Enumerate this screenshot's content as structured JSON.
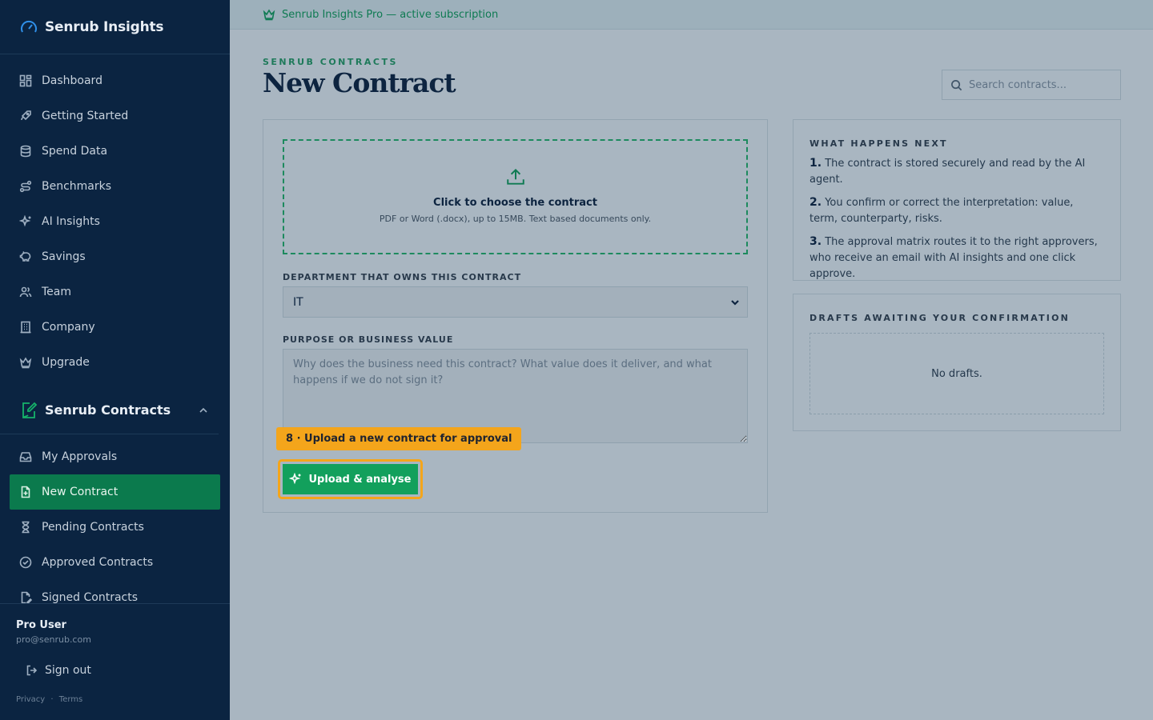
{
  "app": {
    "brand": "Senrub Insights",
    "banner_text": "Senrub Insights Pro — active subscription"
  },
  "sidebar": {
    "items": [
      {
        "label": "Dashboard",
        "icon": "grid-icon"
      },
      {
        "label": "Getting Started",
        "icon": "rocket-icon"
      },
      {
        "label": "Spend Data",
        "icon": "database-icon"
      },
      {
        "label": "Benchmarks",
        "icon": "route-icon"
      },
      {
        "label": "AI Insights",
        "icon": "sparkles-icon"
      },
      {
        "label": "Savings",
        "icon": "piggy-bank-icon"
      },
      {
        "label": "Team",
        "icon": "users-icon"
      },
      {
        "label": "Company",
        "icon": "building-icon"
      },
      {
        "label": "Upgrade",
        "icon": "crown-icon"
      }
    ],
    "section": {
      "title": "Senrub Contracts",
      "items": [
        {
          "label": "My Approvals",
          "icon": "inbox-icon"
        },
        {
          "label": "New Contract",
          "icon": "file-plus-icon",
          "active": true
        },
        {
          "label": "Pending Contracts",
          "icon": "hourglass-icon"
        },
        {
          "label": "Approved Contracts",
          "icon": "check-circle-icon"
        },
        {
          "label": "Signed Contracts",
          "icon": "file-signature-icon"
        }
      ]
    },
    "user": {
      "name": "Pro User",
      "email": "pro@senrub.com",
      "sign_out": "Sign out"
    },
    "footer": {
      "privacy": "Privacy",
      "sep": "·",
      "terms": "Terms"
    }
  },
  "header": {
    "eyebrow": "SENRUB CONTRACTS",
    "title": "New Contract",
    "search_placeholder": "Search contracts..."
  },
  "form": {
    "dropzone_title": "Click to choose the contract",
    "dropzone_sub": "PDF or Word (.docx), up to 15MB. Text based documents only.",
    "department_label": "DEPARTMENT THAT OWNS THIS CONTRACT",
    "department_value": "IT",
    "purpose_label": "PURPOSE OR BUSINESS VALUE",
    "purpose_placeholder": "Why does the business need this contract? What value does it deliver, and what happens if we do not sign it?",
    "hint": "8 · Upload a new contract for approval",
    "submit_label": "Upload & analyse"
  },
  "next": {
    "heading": "WHAT HAPPENS NEXT",
    "steps": [
      {
        "num": "1.",
        "text": " The contract is stored securely and read by the AI agent."
      },
      {
        "num": "2.",
        "text": " You confirm or correct the interpretation: value, term, counterparty, risks."
      },
      {
        "num": "3.",
        "text": " The approval matrix routes it to the right approvers, who receive an email with AI insights and one click approve."
      }
    ]
  },
  "drafts": {
    "heading": "DRAFTS AWAITING YOUR CONFIRMATION",
    "empty": "No drafts."
  },
  "colors": {
    "sidebar_bg": "#0b2441",
    "accent_green": "#12a05c",
    "active_nav": "#0b7a4d",
    "highlight": "#f4a51b"
  }
}
